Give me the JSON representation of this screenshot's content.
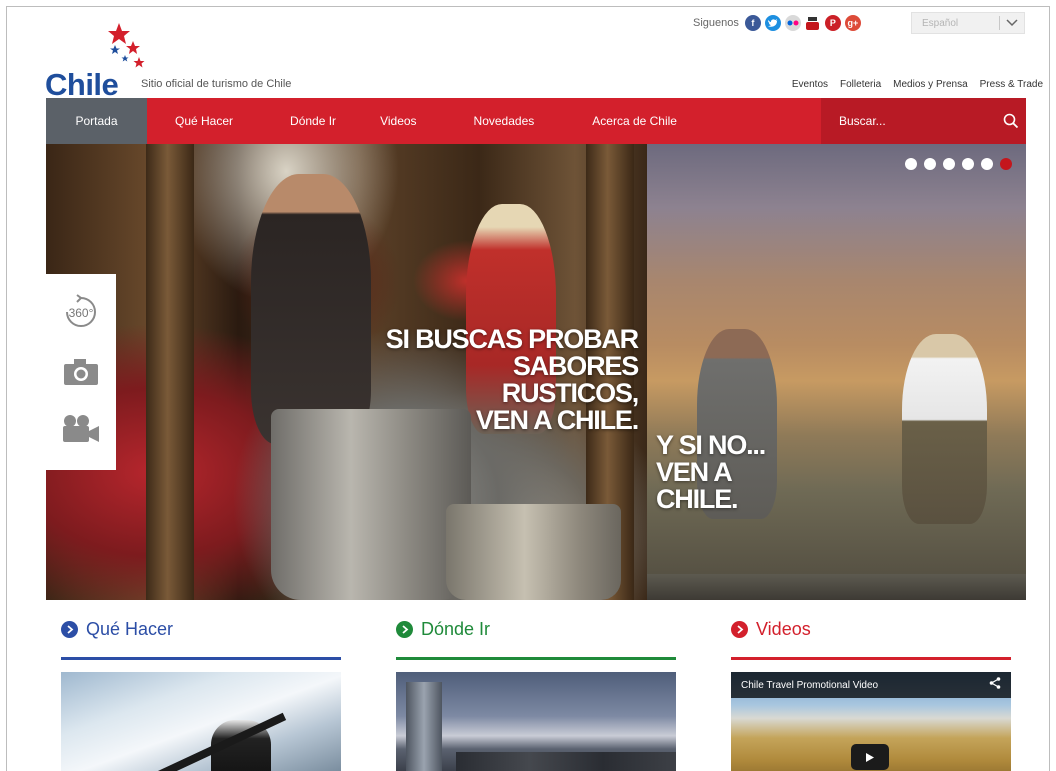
{
  "brand": {
    "name": "Chile",
    "tagline": "Sitio oficial de turismo de Chile"
  },
  "social": {
    "label": "Siguenos",
    "icons": [
      "facebook-icon",
      "twitter-icon",
      "flickr-icon",
      "youtube-icon",
      "pinterest-icon",
      "google-plus-icon"
    ]
  },
  "language": {
    "selected": "Español"
  },
  "top_links": [
    "Eventos",
    "Folleteria",
    "Medios y Prensa",
    "Press & Trade"
  ],
  "nav": {
    "items": [
      "Portada",
      "Qué Hacer",
      "Dónde Ir",
      "Videos",
      "Novedades",
      "Acerca de Chile"
    ],
    "active_index": 0,
    "search_placeholder": "Buscar..."
  },
  "hero": {
    "slogan_lines_1": [
      "SI BUSCAS PROBAR",
      "SABORES RUSTICOS,",
      "VEN A CHILE."
    ],
    "slogan_lines_2": [
      "Y SI NO...",
      "VEN A CHILE."
    ],
    "slide_count": 6,
    "active_slide": 6,
    "media_buttons": [
      "360-icon",
      "camera-icon",
      "video-camera-icon"
    ],
    "label_360": "360°"
  },
  "sections": [
    {
      "title": "Qué Hacer",
      "color": "#2c4ea6"
    },
    {
      "title": "Dónde Ir",
      "color": "#1f8a3a"
    },
    {
      "title": "Videos",
      "color": "#d3202c"
    }
  ],
  "video": {
    "title": "Chile Travel Promotional Video"
  },
  "colors": {
    "nav_red": "#d3202c",
    "nav_active": "#5b6168",
    "search_red": "#b81a25",
    "brand_blue": "#1f4e9c"
  }
}
